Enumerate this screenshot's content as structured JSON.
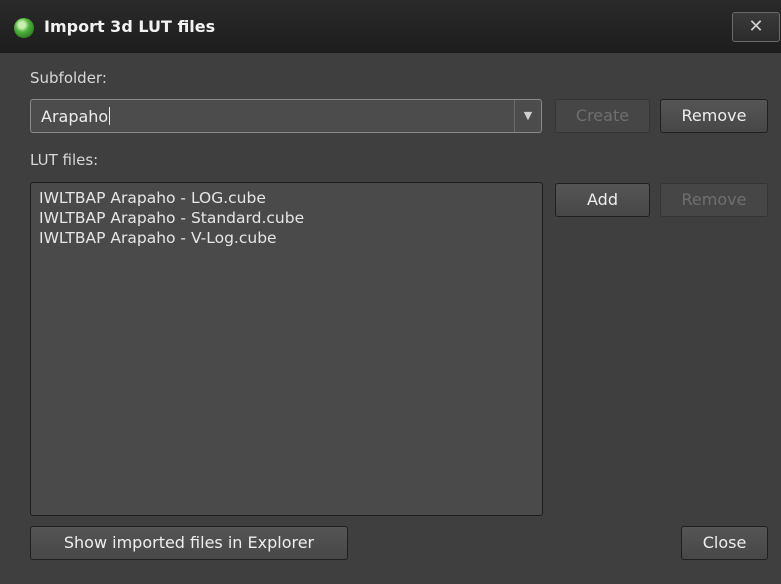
{
  "window": {
    "title": "Import 3d LUT files",
    "close_glyph": "✕"
  },
  "subfolder": {
    "label": "Subfolder:",
    "value": "Arapaho",
    "create_label": "Create",
    "remove_label": "Remove"
  },
  "lut": {
    "label": "LUT files:",
    "files": [
      "IWLTBAP Arapaho - LOG.cube",
      "IWLTBAP Arapaho - Standard.cube",
      "IWLTBAP Arapaho - V-Log.cube"
    ],
    "add_label": "Add",
    "remove_label": "Remove"
  },
  "footer": {
    "show_label": "Show imported files in Explorer",
    "close_label": "Close"
  },
  "icons": {
    "app": "app-logo-icon",
    "close": "close-icon",
    "dropdown": "chevron-down-icon"
  },
  "colors": {
    "dialog_bg": "#3f3f3f",
    "titlebar_bg": "#1e1e1e",
    "button_bg": "#4d4d4d",
    "disabled_text": "#6f6f6f"
  }
}
